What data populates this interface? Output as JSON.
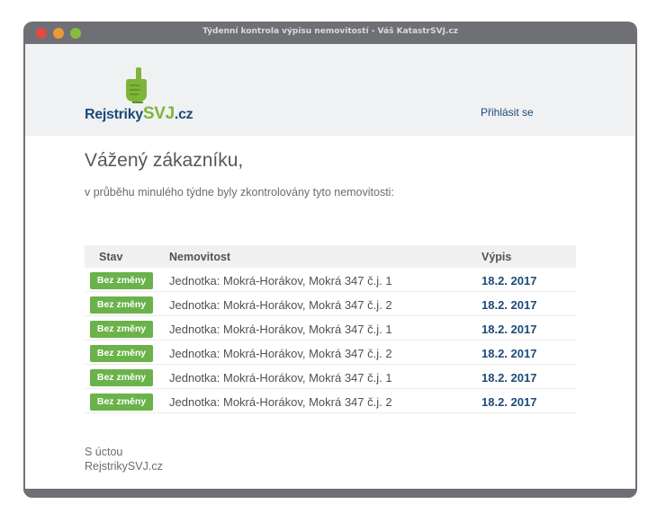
{
  "window": {
    "title": "Týdenní kontrola výpisu nemovitostí - Váš KatastrSVJ.cz"
  },
  "header": {
    "logo": {
      "part1": "Rejstriky",
      "part2": "SVJ",
      "part3": ".cz"
    },
    "login_label": "Přihlásit se"
  },
  "main": {
    "greeting": "Vážený zákazníku,",
    "intro": "v průběhu minulého týdne byly zkontrolovány tyto nemovitosti:",
    "table": {
      "headers": {
        "status": "Stav",
        "property": "Nemovitost",
        "extract": "Výpis"
      },
      "rows": [
        {
          "status": "Bez změny",
          "property": "Jednotka: Mokrá-Horákov, Mokrá 347 č.j. 1",
          "extract": "18.2. 2017"
        },
        {
          "status": "Bez změny",
          "property": "Jednotka: Mokrá-Horákov, Mokrá 347 č.j. 2",
          "extract": "18.2. 2017"
        },
        {
          "status": "Bez změny",
          "property": "Jednotka: Mokrá-Horákov, Mokrá 347 č.j. 1",
          "extract": "18.2. 2017"
        },
        {
          "status": "Bez změny",
          "property": "Jednotka: Mokrá-Horákov, Mokrá 347 č.j. 2",
          "extract": "18.2. 2017"
        },
        {
          "status": "Bez změny",
          "property": "Jednotka: Mokrá-Horákov, Mokrá 347 č.j. 1",
          "extract": "18.2. 2017"
        },
        {
          "status": "Bez změny",
          "property": "Jednotka: Mokrá-Horákov, Mokrá 347 č.j. 2",
          "extract": "18.2. 2017"
        }
      ]
    },
    "closing": {
      "line1": "S úctou",
      "line2": "RejstrikySVJ.cz"
    }
  },
  "colors": {
    "brand_blue": "#1d4a7a",
    "brand_green": "#7fb43a",
    "badge_green": "#6ab24a",
    "window_chrome": "#6e7075"
  }
}
